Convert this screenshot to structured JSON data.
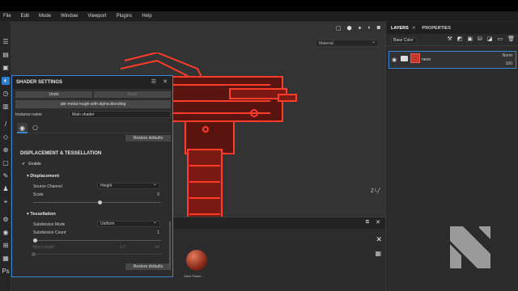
{
  "menu": [
    "File",
    "Edit",
    "Mode",
    "Window",
    "Viewport",
    "Plugins",
    "Help"
  ],
  "viewport": {
    "display_select": "Material",
    "axis_label": "Z"
  },
  "shader_settings": {
    "title": "SHADER SETTINGS",
    "undo_label": "Undo",
    "redo_label": "Redo",
    "shader_name": "pbr-metal-rough-with-alpha-blending",
    "instance_label": "Instance name",
    "instance_value": "Main shader",
    "restore_label": "Restore defaults",
    "section_title": "DISPLACEMENT & TESSELLATION",
    "enable_label": "Enable",
    "displacement": {
      "title": "Displacement",
      "source_label": "Source Channel",
      "source_value": "Height",
      "scale_label": "Scale",
      "scale_value": "0",
      "scale_fraction": 0.52
    },
    "tessellation": {
      "title": "Tessellation",
      "mode_label": "Subdivision Mode",
      "mode_value": "Uniform",
      "count_label": "Subdivision Count",
      "count_value": "1",
      "count_fraction": 0.0,
      "maxlen_label": "Max Length",
      "maxlen_value_a": "1.0",
      "maxlen_value_b": "64"
    },
    "restore_label_2": "Restore defaults"
  },
  "shelf": {
    "items": [
      "",
      "Steel Painte..."
    ]
  },
  "layers": {
    "tab_layers": "LAYERS",
    "tab_properties": "PROPERTIES",
    "channel_select": "Base Color",
    "rows": [
      {
        "name": "neon",
        "blend": "Norm",
        "opacity": "100"
      }
    ]
  },
  "colors": {
    "accent": "#3a86d6",
    "neon": "#ff3b2a"
  }
}
